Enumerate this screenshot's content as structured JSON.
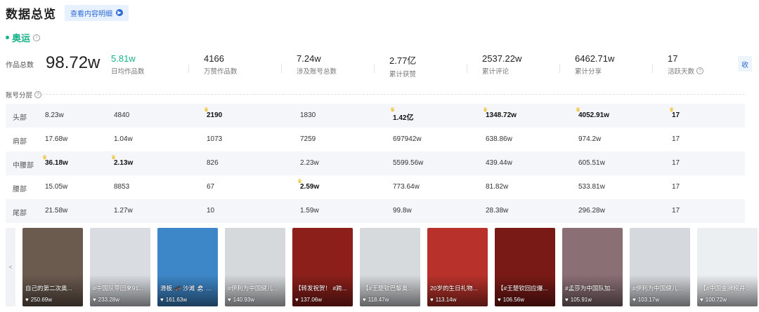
{
  "header": {
    "title": "数据总览",
    "detail_button": "查看内容明细"
  },
  "section": {
    "name": "奥运"
  },
  "summary": {
    "total_label": "作品总数",
    "total_value": "98.72w",
    "stats": [
      {
        "value": "5.81w",
        "label": "日均作品数"
      },
      {
        "value": "4166",
        "label": "万赞作品数"
      },
      {
        "value": "7.24w",
        "label": "涉及账号总数"
      },
      {
        "value": "2.77亿",
        "label": "累计获赞"
      },
      {
        "value": "2537.22w",
        "label": "累计评论"
      },
      {
        "value": "6462.71w",
        "label": "累计分享"
      },
      {
        "value": "17",
        "label": "活跃天数"
      }
    ],
    "collapse_label": "收"
  },
  "tiers": {
    "title": "账号分层",
    "rows": [
      {
        "label": "头部",
        "cells": [
          "8.23w",
          "4840",
          "2190",
          "1830",
          "1.42亿",
          "1348.72w",
          "4052.91w",
          "17"
        ]
      },
      {
        "label": "肩部",
        "cells": [
          "17.68w",
          "1.04w",
          "1073",
          "7259",
          "697942w",
          "638.86w",
          "974.2w",
          "17"
        ]
      },
      {
        "label": "中腰部",
        "cells": [
          "36.18w",
          "2.13w",
          "826",
          "2.23w",
          "5599.56w",
          "439.44w",
          "605.51w",
          "17"
        ]
      },
      {
        "label": "腰部",
        "cells": [
          "15.05w",
          "8853",
          "67",
          "2.59w",
          "773.64w",
          "81.82w",
          "533.81w",
          "17"
        ]
      },
      {
        "label": "尾部",
        "cells": [
          "21.58w",
          "1.27w",
          "10",
          "1.59w",
          "99.8w",
          "28.38w",
          "296.28w",
          "17"
        ]
      }
    ]
  },
  "carousel": {
    "prev_label": "<",
    "cards": [
      {
        "caption": "自己的第二次奥...",
        "likes": "250.69w",
        "color": "#6b5a4e"
      },
      {
        "caption": "#中国队带回来91...",
        "likes": "233.28w",
        "color": "#d9dde2"
      },
      {
        "caption": "滑板 🛹 沙滩 🏖 海...",
        "likes": "161.63w",
        "color": "#3d87c9"
      },
      {
        "caption": "#伊利为中国健儿...",
        "likes": "140.93w",
        "color": "#d6d9dc"
      },
      {
        "caption": "【转发祝贺！ #跨...",
        "likes": "137.06w",
        "color": "#8c1f1a"
      },
      {
        "caption": "【#王楚钦巴黎奥...",
        "likes": "118.47w",
        "color": "#d7dadd"
      },
      {
        "caption": "20岁的生日礼物...",
        "likes": "113.14w",
        "color": "#b8322b"
      },
      {
        "caption": "【#王楚钦回应爆...",
        "likes": "106.56w",
        "color": "#7a1a16"
      },
      {
        "caption": "#孟莎为中国队加...",
        "likes": "105.91w",
        "color": "#8a6f74"
      },
      {
        "caption": "#伊利为中国健儿...",
        "likes": "103.17w",
        "color": "#d5d8dc"
      },
      {
        "caption": "【#中国金牌榜并...",
        "likes": "100.72w",
        "color": "#eceff2"
      }
    ]
  }
}
